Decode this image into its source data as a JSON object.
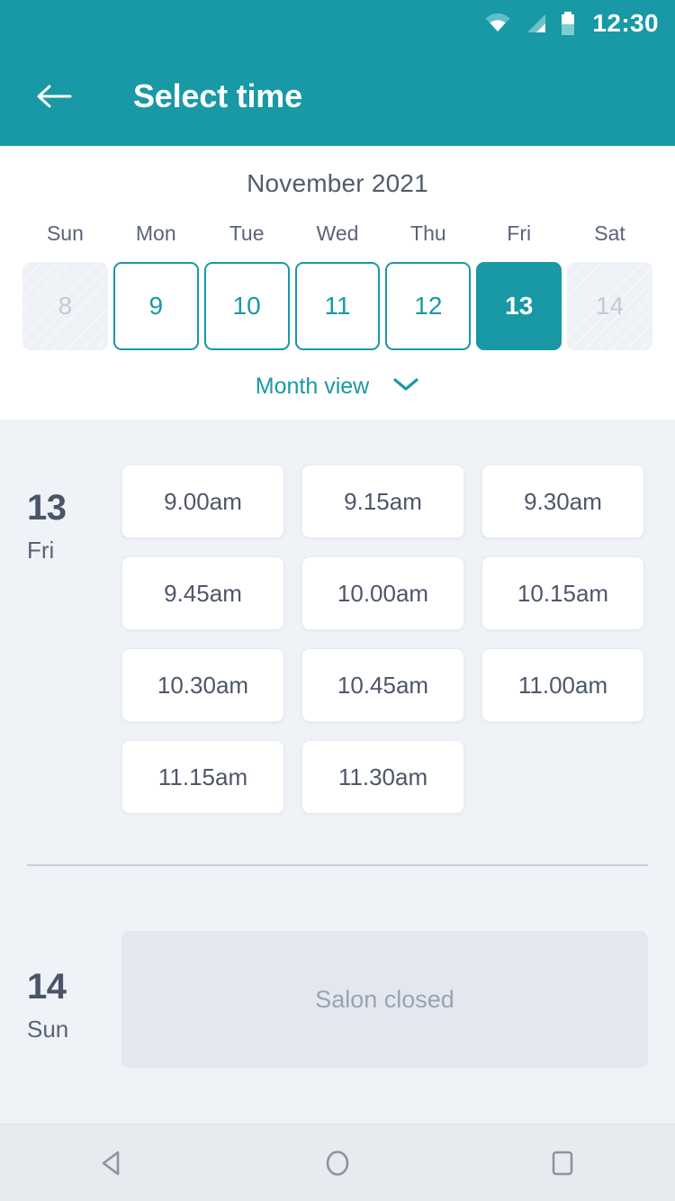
{
  "statusbar": {
    "time": "12:30",
    "icons": [
      "wifi-icon",
      "signal-icon",
      "battery-icon"
    ]
  },
  "appbar": {
    "back_icon": "back-arrow-icon",
    "title": "Select time"
  },
  "calendar": {
    "month_title": "November 2021",
    "weekdays": [
      "Sun",
      "Mon",
      "Tue",
      "Wed",
      "Thu",
      "Fri",
      "Sat"
    ],
    "days": [
      {
        "num": "8",
        "state": "disabled"
      },
      {
        "num": "9",
        "state": "available"
      },
      {
        "num": "10",
        "state": "available"
      },
      {
        "num": "11",
        "state": "available"
      },
      {
        "num": "12",
        "state": "available"
      },
      {
        "num": "13",
        "state": "selected"
      },
      {
        "num": "14",
        "state": "disabled"
      }
    ],
    "month_view_label": "Month view",
    "month_view_icon": "chevron-down-icon"
  },
  "schedule": [
    {
      "day_number": "13",
      "day_name": "Fri",
      "closed": false,
      "slots": [
        "9.00am",
        "9.15am",
        "9.30am",
        "9.45am",
        "10.00am",
        "10.15am",
        "10.30am",
        "10.45am",
        "11.00am",
        "11.15am",
        "11.30am"
      ]
    },
    {
      "day_number": "14",
      "day_name": "Sun",
      "closed": true,
      "closed_label": "Salon closed",
      "slots": []
    }
  ],
  "navbar": {
    "back_label": "back-nav-icon",
    "home_label": "home-nav-icon",
    "recents_label": "recents-nav-icon"
  },
  "colors": {
    "accent": "#1899a5",
    "page_bg": "#eff2f7",
    "text_dark": "#4a5568",
    "text_muted": "#9aa3b2"
  }
}
